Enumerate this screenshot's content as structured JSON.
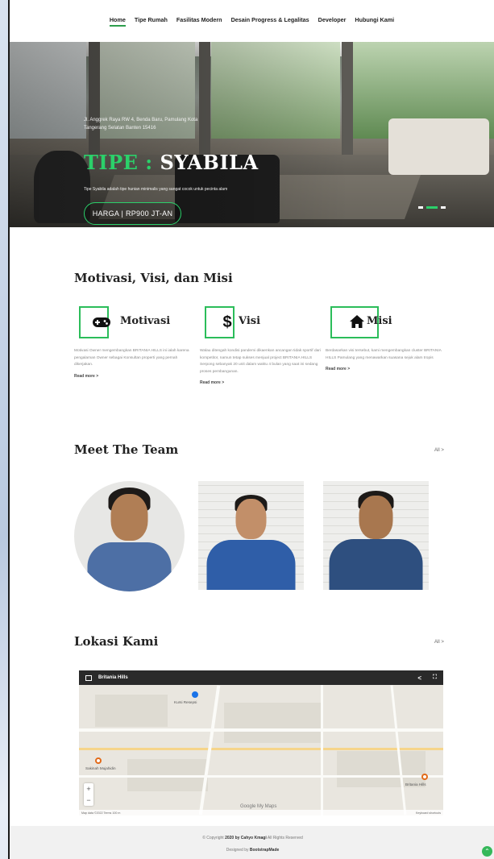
{
  "nav": {
    "items": [
      {
        "label": "Home",
        "active": true
      },
      {
        "label": "Tipe Rumah",
        "active": false
      },
      {
        "label": "Fasilitas Modern",
        "active": false
      },
      {
        "label": "Desain Progress & Legalitas",
        "active": false
      },
      {
        "label": "Developer",
        "active": false
      },
      {
        "label": "Hubungi Kami",
        "active": false
      }
    ]
  },
  "hero": {
    "address": "Jl. Anggrek Raya RW 4, Benda Baru, Pamulang Kota Tangerang Selatan Banten 15416",
    "title_keyword": "TIPE : ",
    "title_value": "SYABILA",
    "description": "Tipe Syabila adalah tipe hunian minimalis yang sangat cocok untuk pecinta alam",
    "price_button": "HARGA | RP900 JT-AN",
    "slides_total": 3,
    "active_slide": 2,
    "accent_color": "#2bd06a"
  },
  "mission": {
    "title": "Motivasi, Visi, dan Misi",
    "cards": [
      {
        "icon": "gamepad-icon",
        "label": "Motivasi",
        "text": "Motivasi Owner mengembangkan BRITANIA HILLS ini ialah karena pengalaman Owner sebagai Konsultan properti yang pernah dikerjakan.",
        "more": "Read more >"
      },
      {
        "icon": "dollar-icon",
        "label": "Visi",
        "text": "Walau ditengah kondisi pandemi dikaenkan ancangan tidak sportif dari kompetitor, namun tetap sukses menjual project BRITANIA HILLS Serpong sebanyak 20 unit dalam waktu 4 bulan yang saat ini sedang proses pembangunan.",
        "more": "Read more >"
      },
      {
        "icon": "home-icon",
        "label": "Misi",
        "text": "Berdasarkan visi tersebut, kami mengembangkan cluster BRITANIA HILLS Pamulang yang menawarkan suasana sejuk alam tropis",
        "more": "Read more >"
      }
    ]
  },
  "team": {
    "title": "Meet The Team",
    "all_link": "All >"
  },
  "location": {
    "title": "Lokasi Kami",
    "all_link": "All >",
    "map_title": "Britania Hills",
    "places": [
      "Kursi Resepsi",
      "Sakinah Mujahidin",
      "Britania Hills"
    ],
    "google": "Google My Maps",
    "map_footer_left": "Map data ©2022  Terms  100 m",
    "map_footer_right": "Keyboard shortcuts"
  },
  "footer": {
    "copy_pre": "© Copyright ",
    "copy_year": "2020",
    "copy_by": " by Cahyo Kmagi",
    "copy_post": " All Rights Reserved",
    "designed_pre": "Designed by ",
    "designed_by": "BootstrapMade"
  }
}
